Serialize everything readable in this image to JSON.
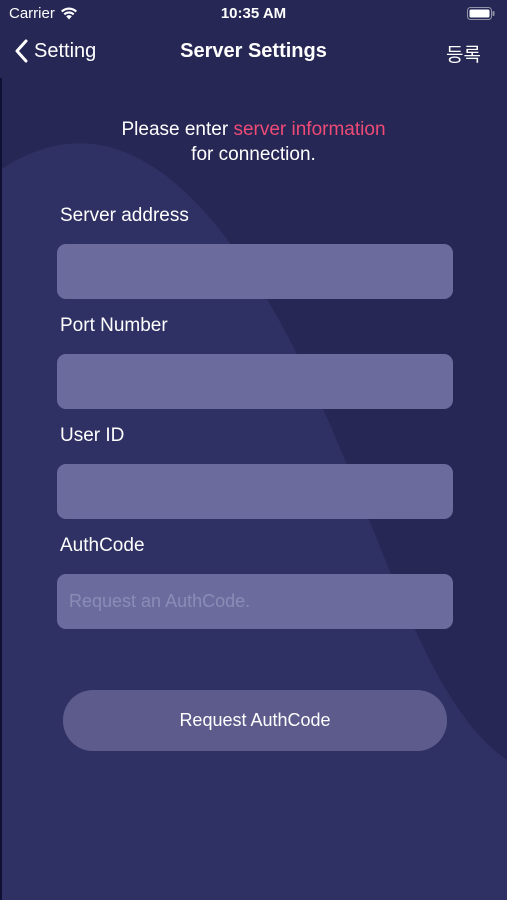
{
  "status_bar": {
    "carrier": "Carrier",
    "time": "10:35 AM"
  },
  "nav": {
    "back_label": "Setting",
    "title": "Server Settings",
    "right_action": "등록"
  },
  "intro": {
    "prefix": "Please enter ",
    "highlight": "server information",
    "suffix": "for connection."
  },
  "form": {
    "server_address": {
      "label": "Server address",
      "value": "",
      "placeholder": ""
    },
    "port_number": {
      "label": "Port Number",
      "value": "",
      "placeholder": ""
    },
    "user_id": {
      "label": "User ID",
      "value": "",
      "placeholder": ""
    },
    "auth_code": {
      "label": "AuthCode",
      "value": "",
      "placeholder": "Request an AuthCode."
    }
  },
  "request_button": {
    "label": "Request AuthCode"
  },
  "colors": {
    "background": "#262754",
    "field": "#6b6c9d",
    "button": "#5c5b8c",
    "accent": "#ee4a76"
  },
  "icons": {
    "wifi": "wifi-icon",
    "battery": "battery-icon",
    "back": "chevron-left-icon"
  }
}
